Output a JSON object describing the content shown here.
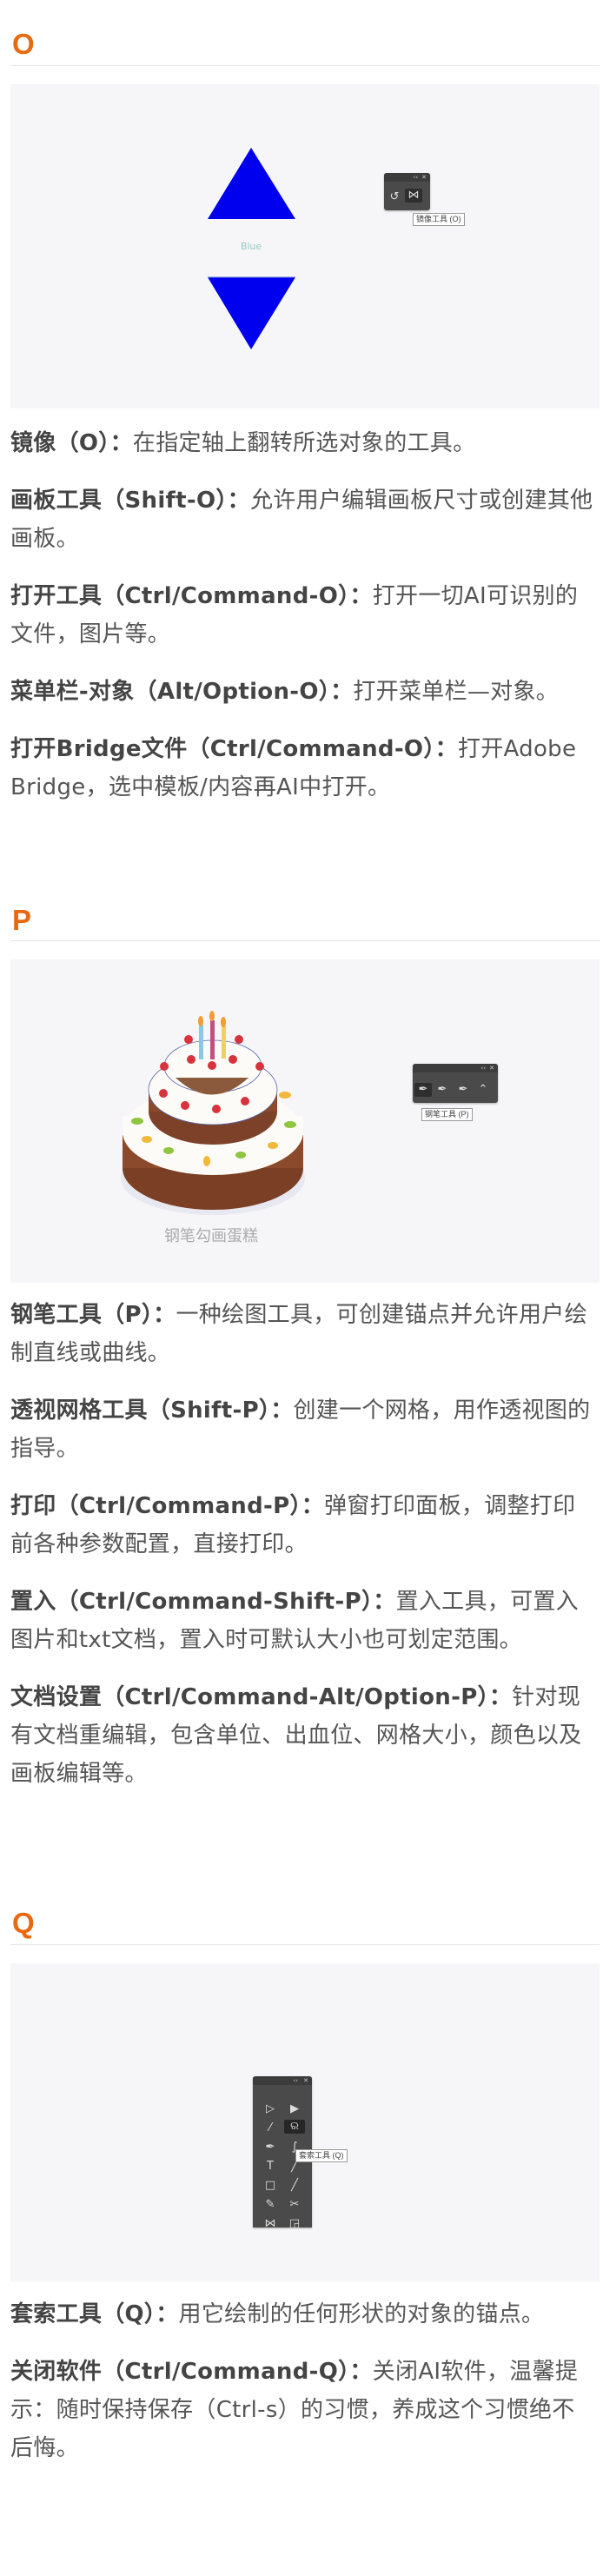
{
  "colors": {
    "heading": "#e8690f",
    "figure_bg": "#f6f6f8",
    "text": "#555555",
    "triangle": "#0000ee"
  },
  "sections": [
    {
      "letter": "O",
      "figure": {
        "label": "Blue",
        "tooltip": "镜像工具 (O)",
        "panel_icons": [
          "rotate-icon",
          "reflect-icon"
        ]
      },
      "items": [
        {
          "term": "镜像（O）：",
          "desc": "在指定轴上翻转所选对象的工具。"
        },
        {
          "term": "画板工具（Shift-O）：",
          "desc": "允许用户编辑画板尺寸或创建其他画板。"
        },
        {
          "term": "打开工具（Ctrl/Command-O）：",
          "desc": "打开一切AI可识别的文件，图片等。"
        },
        {
          "term": "菜单栏-对象（Alt/Option-O）：",
          "desc": "打开菜单栏—对象。"
        },
        {
          "term": "打开Bridge文件（Ctrl/Command-O）：",
          "desc": "打开Adobe Bridge，选中模板/内容再AI中打开。"
        }
      ]
    },
    {
      "letter": "P",
      "figure": {
        "caption": "钢笔勾画蛋糕",
        "tooltip": "钢笔工具 (P)",
        "panel_icons": [
          "pen-icon",
          "add-anchor-icon",
          "delete-anchor-icon",
          "anchor-point-icon"
        ]
      },
      "items": [
        {
          "term": "钢笔工具（P）：",
          "desc": "一种绘图工具，可创建锚点并允许用户绘制直线或曲线。"
        },
        {
          "term": "透视网格工具（Shift-P）：",
          "desc": "创建一个网格，用作透视图的指导。"
        },
        {
          "term": "打印（Ctrl/Command-P）：",
          "desc": "弹窗打印面板，调整打印前各种参数配置，直接打印。"
        },
        {
          "term": "置入（Ctrl/Command-Shift-P）：",
          "desc": "置入工具，可置入图片和txt文档，置入时可默认大小也可划定范围。"
        },
        {
          "term": "文档设置（Ctrl/Command-Alt/Option-P）：",
          "desc": "针对现有文档重编辑，包含单位、出血位、网格大小，颜色以及画板编辑等。"
        }
      ]
    },
    {
      "letter": "Q",
      "figure": {
        "tooltip": "套索工具 (Q)"
      },
      "items": [
        {
          "term": "套索工具（Q）：",
          "desc": "用它绘制的任何形状的对象的锚点。"
        },
        {
          "term": "关闭软件（Ctrl/Command-Q）：",
          "desc": "关闭AI软件，温馨提示：随时保持保存（Ctrl-s）的习惯，养成这个习惯绝不后悔。"
        }
      ]
    }
  ]
}
